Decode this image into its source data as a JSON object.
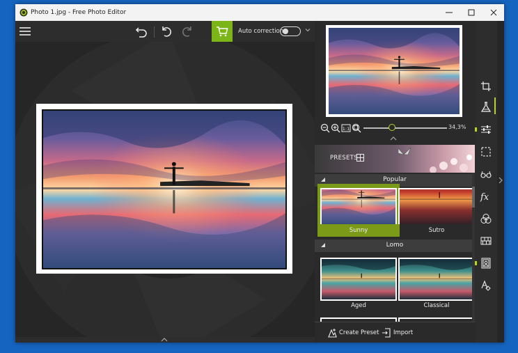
{
  "window": {
    "title": "Photo 1.jpg - Free Photo Editor"
  },
  "toolbar": {
    "auto_correction_label": "Auto correction",
    "auto_correction_on": false
  },
  "navigator": {
    "zoom_value": "34,3%",
    "zoom_level": 0.343
  },
  "presets": {
    "banner_label": "PRESETS",
    "sections": [
      {
        "name": "Popular",
        "items": [
          {
            "name": "Sunny",
            "selected": true
          },
          {
            "name": "Sutro",
            "selected": false
          }
        ]
      },
      {
        "name": "Lomo",
        "items": [
          {
            "name": "Aged",
            "selected": false
          },
          {
            "name": "Classical",
            "selected": false
          }
        ]
      }
    ]
  },
  "actions": {
    "create_preset": "Create Preset",
    "import": "Import"
  },
  "right_bar_icons": [
    "crop-icon",
    "flask-icon",
    "sliders-icon",
    "selection-icon",
    "glasses-icon",
    "fx-icon",
    "color-circles-icon",
    "frame-grid-icon",
    "portrait-icon",
    "text-shapes-icon"
  ],
  "colors": {
    "accent": "#7cb518",
    "accent_light": "#b5d334",
    "desktop": "#1565c0"
  }
}
